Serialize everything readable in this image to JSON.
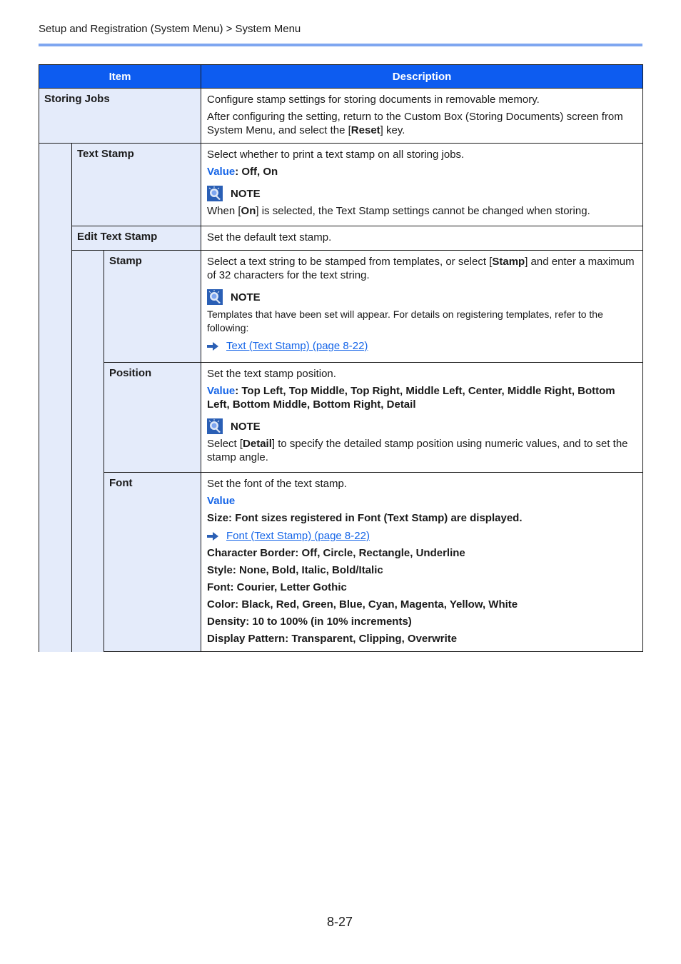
{
  "header": {
    "breadcrumb": "Setup and Registration (System Menu) > System Menu"
  },
  "table": {
    "columns": {
      "item": "Item",
      "description": "Description"
    },
    "rows": {
      "storing_jobs": {
        "item": "Storing Jobs",
        "desc1": "Configure stamp settings for storing documents in removable memory.",
        "desc2_pre": "After configuring the setting, return to the Custom Box (Storing Documents) screen from System Menu, and select the [",
        "desc2_bold": "Reset",
        "desc2_post": "] key."
      },
      "text_stamp": {
        "item": "Text Stamp",
        "desc": "Select whether to print a text stamp on all storing jobs.",
        "value_label": "Value",
        "value_text": ": Off, On",
        "note_label": "NOTE",
        "note_pre": "When [",
        "note_bold": "On",
        "note_post": "] is selected, the Text Stamp settings cannot be changed when storing."
      },
      "edit_text_stamp": {
        "item": "Edit Text Stamp",
        "desc": "Set the default text stamp."
      },
      "stamp": {
        "item": "Stamp",
        "desc_pre": "Select a text string to be stamped from templates, or select [",
        "desc_bold": "Stamp",
        "desc_post": "] and enter a maximum of 32 characters for the text string.",
        "note_label": "NOTE",
        "note_text": "Templates that have been set will appear. For details on registering templates, refer to the following:",
        "link": "Text (Text Stamp) (page 8-22)"
      },
      "position": {
        "item": "Position",
        "desc": "Set the text stamp position.",
        "value_label": "Value",
        "value_text": ": Top Left, Top Middle, Top Right, Middle Left, Center, Middle Right, Bottom Left, Bottom Middle, Bottom Right, Detail",
        "note_label": "NOTE",
        "note_pre": "Select [",
        "note_bold": "Detail",
        "note_post": "] to specify the detailed stamp position using numeric values, and to set the stamp angle."
      },
      "font": {
        "item": "Font",
        "desc": "Set the font of the text stamp.",
        "value_label": "Value",
        "size": "Size: Font sizes registered in Font (Text Stamp) are displayed.",
        "link": "Font (Text Stamp) (page 8-22)",
        "character_border": "Character Border: Off, Circle, Rectangle, Underline",
        "style": "Style: None, Bold, Italic, Bold/Italic",
        "font": "Font: Courier, Letter Gothic",
        "color": "Color: Black, Red, Green, Blue, Cyan, Magenta, Yellow, White",
        "density": "Density: 10 to 100% (in 10% increments)",
        "display_pattern": "Display Pattern: Transparent, Clipping, Overwrite"
      }
    }
  },
  "footer": {
    "page_number": "8-27"
  },
  "colors": {
    "header_blue": "#0d5cf0",
    "rule_blue": "#7ea6f0",
    "item_bg": "#e4ebfa",
    "value_blue": "#1565e8"
  }
}
